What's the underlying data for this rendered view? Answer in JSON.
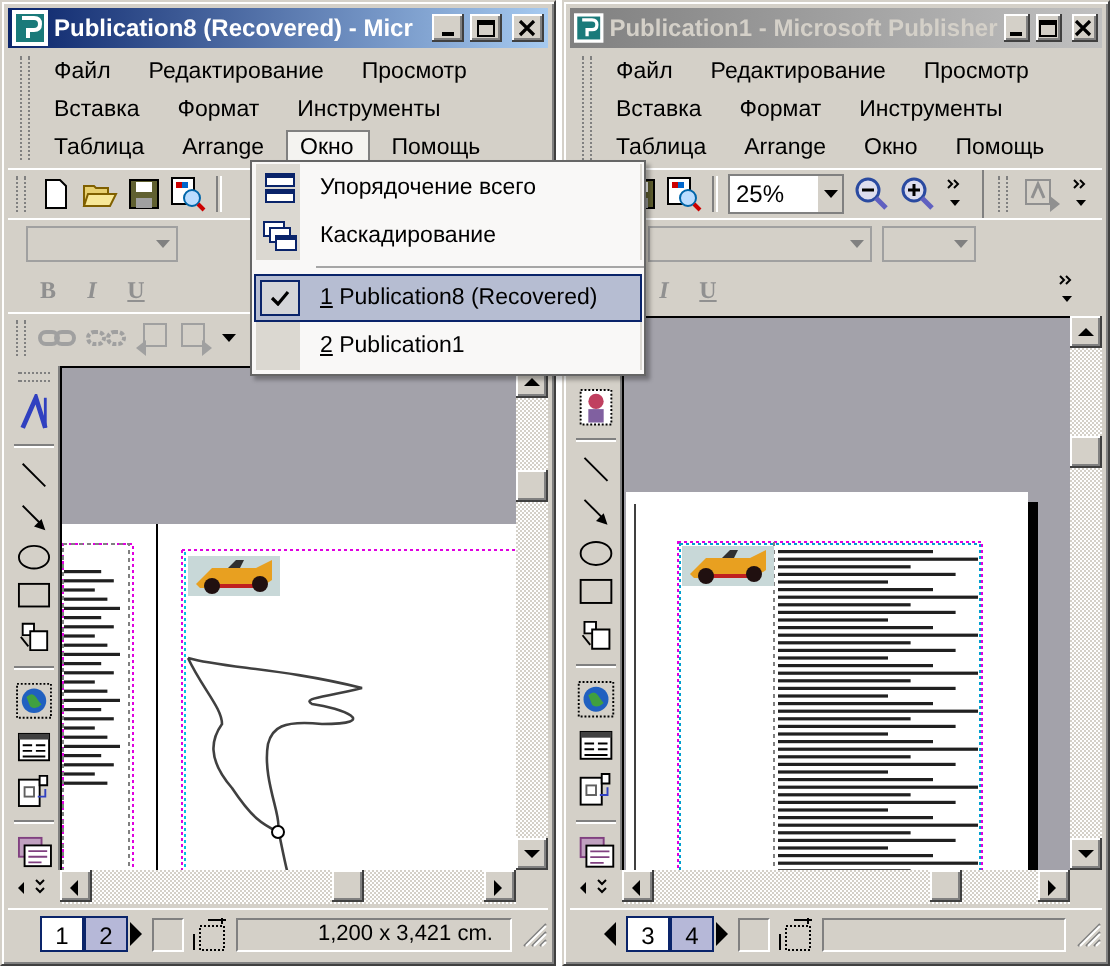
{
  "windows": [
    {
      "kind": "spread",
      "title": "Publication8 (Recovered) - Micr",
      "active": true,
      "menu_rows": [
        {
          "items": [
            {
              "label": "Файл",
              "selected": false
            },
            {
              "label": "Редактирование",
              "selected": false
            },
            {
              "label": "Просмотр",
              "selected": false
            }
          ]
        },
        {
          "items": [
            {
              "label": "Вставка",
              "selected": false
            },
            {
              "label": "Формат",
              "selected": false
            },
            {
              "label": "Инструменты",
              "selected": false
            }
          ]
        },
        {
          "items": [
            {
              "label": "Таблица",
              "selected": false
            },
            {
              "label": "Arrange",
              "selected": false
            },
            {
              "label": "Окно",
              "selected": true
            },
            {
              "label": "Помощь",
              "selected": false
            }
          ]
        }
      ],
      "format_buttons": [
        "B",
        "I",
        "U"
      ],
      "pages": [
        {
          "label": "1",
          "selected": false
        },
        {
          "label": "2",
          "selected": true
        }
      ],
      "dimensions": "1,200 x 3,421 cm."
    },
    {
      "kind": "single",
      "title": "Publication1 - Microsoft Publisher",
      "active": false,
      "menu_rows": [
        {
          "items": [
            {
              "label": "Файл",
              "selected": false
            },
            {
              "label": "Редактирование",
              "selected": false
            },
            {
              "label": "Просмотр",
              "selected": false
            }
          ]
        },
        {
          "items": [
            {
              "label": "Вставка",
              "selected": false
            },
            {
              "label": "Формат",
              "selected": false
            },
            {
              "label": "Инструменты",
              "selected": false
            }
          ]
        },
        {
          "items": [
            {
              "label": "Таблица",
              "selected": false
            },
            {
              "label": "Arrange",
              "selected": false
            },
            {
              "label": "Окно",
              "selected": false
            },
            {
              "label": "Помощь",
              "selected": false
            }
          ]
        }
      ],
      "zoom": "25%",
      "format_buttons": [
        "I",
        "U"
      ],
      "pages": [
        {
          "label": "3",
          "selected": false
        },
        {
          "label": "4",
          "selected": true
        }
      ]
    }
  ],
  "window_menu": {
    "items": [
      {
        "kind": "command",
        "label": "Упорядочение всего"
      },
      {
        "kind": "command",
        "label": "Каскадирование"
      },
      {
        "kind": "separator"
      },
      {
        "kind": "window",
        "number": "1",
        "label": "Publication8 (Recovered)",
        "checked": true,
        "selected": true
      },
      {
        "kind": "window",
        "number": "2",
        "label": "Publication1",
        "checked": false,
        "selected": false
      }
    ]
  }
}
